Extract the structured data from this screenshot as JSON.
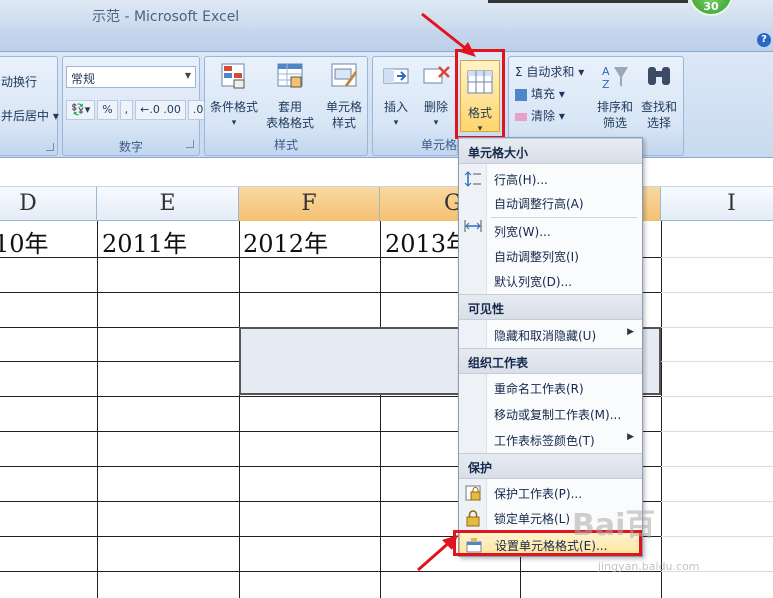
{
  "window": {
    "title": "示范 - Microsoft Excel",
    "badge": "30"
  },
  "ribbon": {
    "alignment": {
      "wrap_text": "动换行",
      "merge_center": "并后居中"
    },
    "number": {
      "format_value": "常规",
      "label": "数字",
      "pct": "%",
      "comma": ",",
      "inc": "←.0 .00",
      "dec": ".00 →.0"
    },
    "styles": {
      "label": "样式",
      "conditional": "条件格式",
      "table_format": [
        "套用",
        "表格格式"
      ],
      "cell_style": [
        "单元格",
        "样式"
      ]
    },
    "cells": {
      "label": "单元格",
      "insert": "插入",
      "delete": "删除",
      "format": "格式"
    },
    "editing": {
      "autosum": "Σ 自动求和",
      "fill": "填充",
      "clear": "清除",
      "sort": [
        "排序和",
        "筛选"
      ],
      "find": [
        "查找和",
        "选择"
      ]
    }
  },
  "sheet": {
    "columns": [
      "D",
      "E",
      "F",
      "G",
      "I"
    ],
    "years": [
      "10年",
      "2011年",
      "2012年",
      "2013年"
    ]
  },
  "menu": {
    "header_size": "单元格大小",
    "row_height": "行高(H)...",
    "autofit_row": "自动调整行高(A)",
    "col_width": "列宽(W)...",
    "autofit_col": "自动调整列宽(I)",
    "default_width": "默认列宽(D)...",
    "header_visibility": "可见性",
    "hide_unhide": "隐藏和取消隐藏(U)",
    "header_organize": "组织工作表",
    "rename": "重命名工作表(R)",
    "move_copy": "移动或复制工作表(M)...",
    "tab_color": "工作表标签颜色(T)",
    "header_protect": "保护",
    "protect_sheet": "保护工作表(P)...",
    "lock_cell": "锁定单元格(L)",
    "format_cells": "设置单元格格式(E)..."
  },
  "watermark": {
    "logo": "Bai百",
    "url": "jingyan.baidu.com"
  },
  "colors": {
    "highlight": "#e0141e",
    "accent": "#f4c172"
  }
}
